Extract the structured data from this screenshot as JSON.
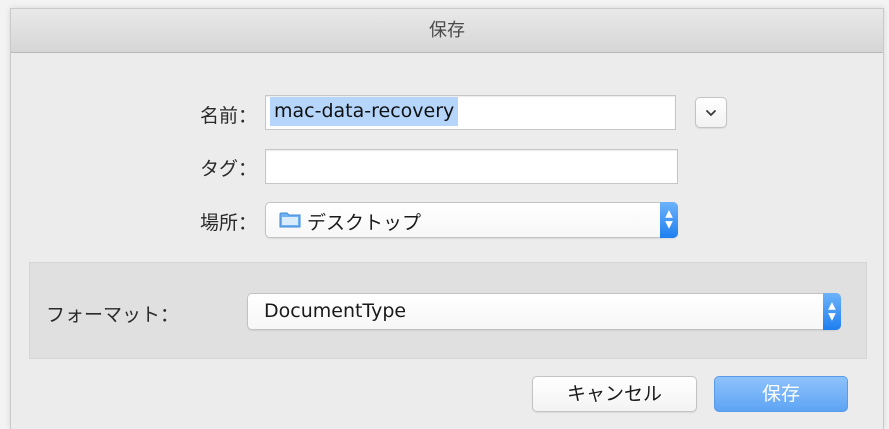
{
  "window": {
    "title": "保存"
  },
  "form": {
    "name_label": "名前：",
    "name_value": "mac-data-recovery",
    "tags_label": "タグ：",
    "tags_value": "",
    "location_label": "場所：",
    "location_value": "デスクトップ",
    "location_icon": "folder-icon"
  },
  "options": {
    "format_label": "フォーマット：",
    "format_value": "DocumentType"
  },
  "buttons": {
    "cancel_label": "キャンセル",
    "save_label": "保存",
    "expand_icon": "chevron-down-icon"
  },
  "colors": {
    "accent": "#5ea4f4",
    "selection": "#b5d5fb",
    "stepper": "#1f7ff0"
  }
}
